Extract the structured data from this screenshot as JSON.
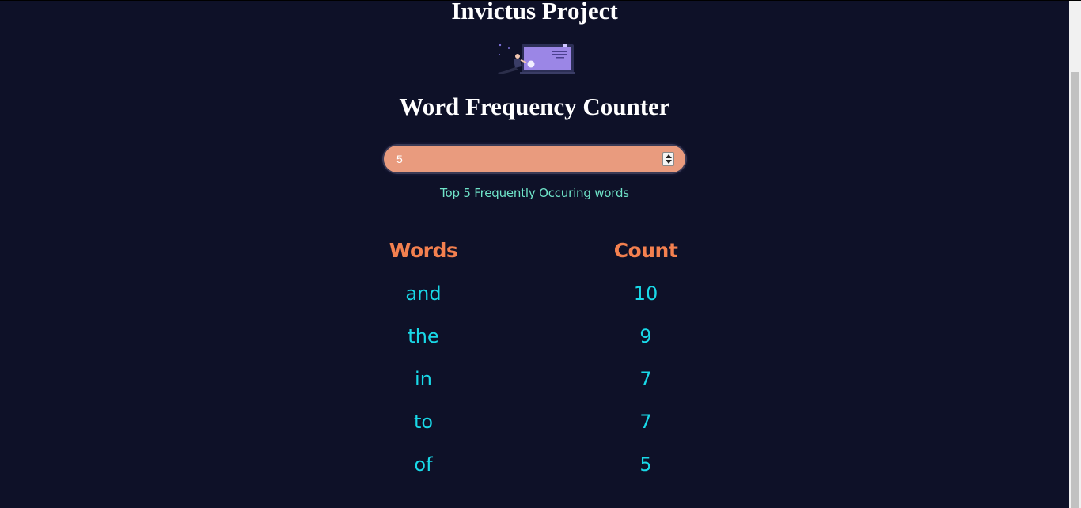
{
  "header": {
    "site_title": "Invictus Project",
    "illustration_icon": "person-with-laptop-illustration"
  },
  "main": {
    "app_title": "Word Frequency Counter",
    "count_input": {
      "value": "5"
    },
    "caption": "Top 5 Frequently Occuring words"
  },
  "table": {
    "headers": [
      "Words",
      "Count"
    ],
    "rows": [
      {
        "word": "and",
        "count": "10"
      },
      {
        "word": "the",
        "count": "9"
      },
      {
        "word": "in",
        "count": "7"
      },
      {
        "word": "to",
        "count": "7"
      },
      {
        "word": "of",
        "count": "5"
      }
    ]
  },
  "colors": {
    "background": "#0e1128",
    "accent_header": "#f3804f",
    "cell_text": "#19d9e8",
    "caption_text": "#6fe3c8",
    "input_bg": "#e99b7e"
  }
}
